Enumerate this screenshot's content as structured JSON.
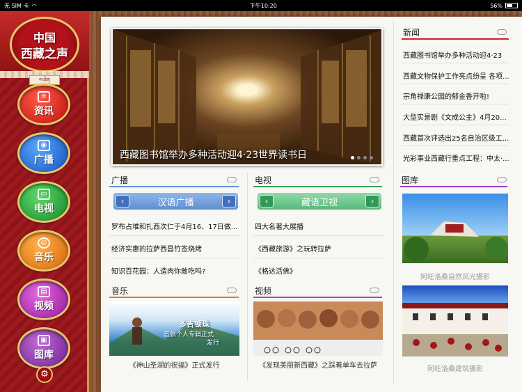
{
  "status": {
    "carrier": "无 SIM 卡",
    "time": "下午10:20",
    "battery": "56%",
    "battery_level": 0.56
  },
  "sidebar": {
    "logo_line1": "中国",
    "logo_line2": "西藏之声",
    "logo_tibetan": "ས་ཆེན",
    "nav": [
      {
        "label": "资讯",
        "icon": "news-icon"
      },
      {
        "label": "广播",
        "icon": "radio-icon"
      },
      {
        "label": "电视",
        "icon": "tv-icon"
      },
      {
        "label": "音乐",
        "icon": "music-icon"
      },
      {
        "label": "视频",
        "icon": "video-icon"
      },
      {
        "label": "图库",
        "icon": "gallery-icon"
      }
    ]
  },
  "hero": {
    "caption": "西藏图书馆举办多种活动迎4·23世界读书日",
    "slides": 4,
    "active_slide": 1
  },
  "news": {
    "title": "新闻",
    "items": [
      "西藏图书馆举办多种活动迎4·23",
      "西藏文物保护工作亮点纷呈 各项...",
      "宗角禄康公园的郁金香开啦!",
      "大型实景剧《文成公主》4月20...",
      "西藏首次评选出25名自治区级工...",
      "光彩事业西藏行重点工程：中太·..."
    ]
  },
  "radio": {
    "title": "广播",
    "channel": "汉语广播",
    "items": [
      "罗布占堆和扎西次仁于4月16、17日做...",
      "经济实惠的拉萨西昌竹签烧烤",
      "知识百花园：人造肉你敢吃吗?"
    ]
  },
  "tv": {
    "title": "电视",
    "channel": "藏语卫视",
    "items": [
      "四大名著大展播",
      "《西藏旅游》之玩转拉萨",
      "《格达活佛》"
    ]
  },
  "music": {
    "title": "音乐",
    "caption": "《神山圣湖的祝福》正式发行",
    "banner_line1": "多吉顿珠",
    "banner_line2": "首张个人专辑正式",
    "banner_line3": "发行"
  },
  "video": {
    "title": "视频",
    "caption": "《发现美丽新西藏》之踩着单车去拉萨"
  },
  "gallery": {
    "title": "图库",
    "items": [
      "阿旺洛桑自然风光摄影",
      "阿旺洛桑建筑摄影"
    ]
  },
  "colors": {
    "news_line": "#d9202a",
    "radio_line": "#6a8fd8",
    "tv_line": "#3aa05a",
    "music_line": "#e07a20",
    "video_line": "#c23bb0",
    "gallery_line": "#9a3bc0"
  }
}
